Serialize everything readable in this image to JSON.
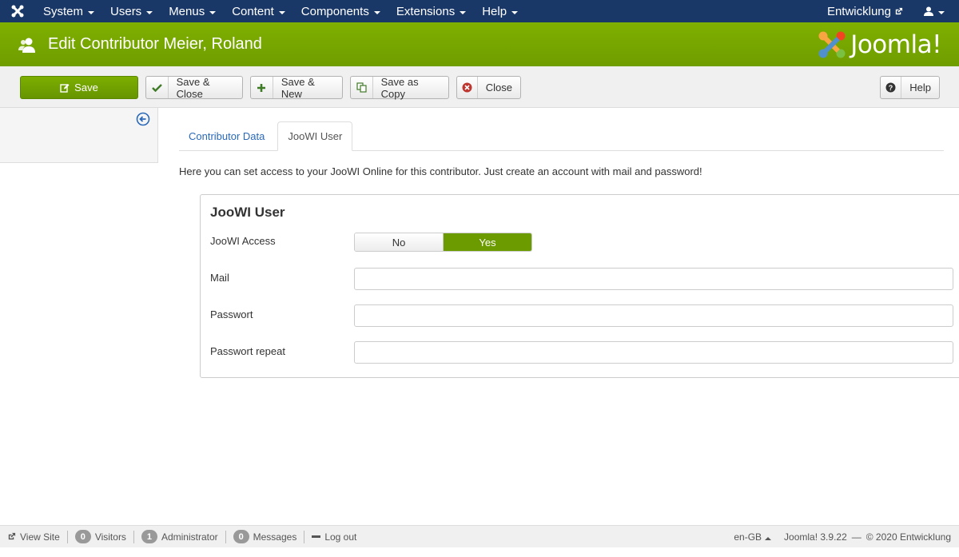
{
  "navbar": {
    "menu": [
      {
        "label": "System"
      },
      {
        "label": "Users"
      },
      {
        "label": "Menus"
      },
      {
        "label": "Content"
      },
      {
        "label": "Components"
      },
      {
        "label": "Extensions"
      },
      {
        "label": "Help"
      }
    ],
    "site_name": "Entwicklung",
    "color": "#1a3867"
  },
  "header": {
    "title": "Edit Contributor Meier, Roland",
    "brand": "Joomla!",
    "color": "#75a600"
  },
  "toolbar": {
    "save": "Save",
    "save_close": "Save & Close",
    "save_new": "Save & New",
    "save_copy": "Save as Copy",
    "close": "Close",
    "help": "Help"
  },
  "tabs": [
    {
      "label": "Contributor Data",
      "active": false
    },
    {
      "label": "JooWI User",
      "active": true
    }
  ],
  "intro": "Here you can set access to your JooWI Online for this contributor. Just create an account with mail and password!",
  "form": {
    "legend": "JooWI User",
    "access": {
      "label": "JooWI Access",
      "no": "No",
      "yes": "Yes",
      "selected": "Yes"
    },
    "mail": {
      "label": "Mail",
      "value": ""
    },
    "password": {
      "label": "Passwort",
      "value": ""
    },
    "password_repeat": {
      "label": "Passwort repeat",
      "value": ""
    }
  },
  "footer": {
    "view_site": "View Site",
    "visitors": {
      "count": "0",
      "label": "Visitors"
    },
    "administrator": {
      "count": "1",
      "label": "Administrator"
    },
    "messages": {
      "count": "0",
      "label": "Messages"
    },
    "logout": "Log out",
    "language": "en-GB",
    "version": "Joomla! 3.9.22",
    "copyright": "© 2020 Entwicklung",
    "separator": "—"
  }
}
